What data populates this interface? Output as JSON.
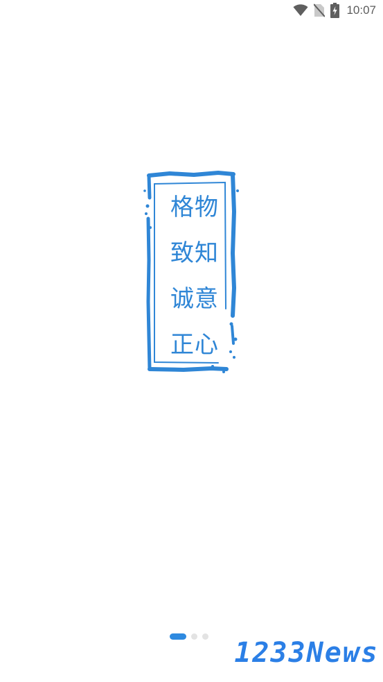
{
  "status_bar": {
    "time": "10:07",
    "icons": [
      "wifi-icon",
      "no-sim-icon",
      "battery-charging-icon"
    ]
  },
  "seal": {
    "lines": [
      "格物",
      "致知",
      "诚意",
      "正心"
    ],
    "color": "#2f86d6"
  },
  "pager": {
    "total": 3,
    "active_index": 0,
    "active_color": "#2e8ae0",
    "inactive_color": "#e3e3e3"
  },
  "watermark": {
    "text": "1233News",
    "color": "#2b7fe6"
  }
}
